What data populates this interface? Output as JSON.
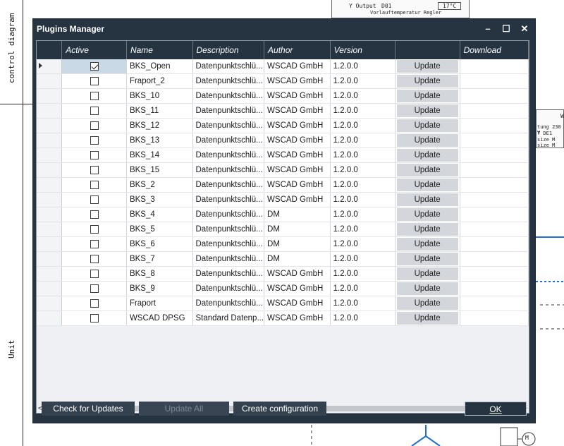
{
  "background": {
    "side_labels": [
      "control diagram",
      "Unit"
    ],
    "top_block": [
      "Y Output",
      "D01",
      "17°C",
      "Vorlauftemperatur Regler"
    ],
    "right_block": [
      "W",
      "tung 230 V",
      "T DE1",
      "size M",
      "size M"
    ]
  },
  "dialog": {
    "title": "Plugins Manager",
    "controls": {
      "minimize": "–",
      "maximize": "☐",
      "close": "✕"
    },
    "columns": [
      "Active",
      "Name",
      "Description",
      "Author",
      "Version",
      "",
      "Download"
    ],
    "rows": [
      {
        "active": true,
        "name": "BKS_Open",
        "description": "Datenpunktschlü...",
        "author": "WSCAD GmbH",
        "version": "1.2.0.0",
        "action": "Update",
        "selected": true
      },
      {
        "active": false,
        "name": "Fraport_2",
        "description": "Datenpunktschlü...",
        "author": "WSCAD GmbH",
        "version": "1.2.0.0",
        "action": "Update"
      },
      {
        "active": false,
        "name": "BKS_10",
        "description": "Datenpunktschlü...",
        "author": "WSCAD GmbH",
        "version": "1.2.0.0",
        "action": "Update"
      },
      {
        "active": false,
        "name": "BKS_11",
        "description": "Datenpunktschlü...",
        "author": "WSCAD GmbH",
        "version": "1.2.0.0",
        "action": "Update"
      },
      {
        "active": false,
        "name": "BKS_12",
        "description": "Datenpunktschlü...",
        "author": "WSCAD GmbH",
        "version": "1.2.0.0",
        "action": "Update"
      },
      {
        "active": false,
        "name": "BKS_13",
        "description": "Datenpunktschlü...",
        "author": "WSCAD GmbH",
        "version": "1.2.0.0",
        "action": "Update"
      },
      {
        "active": false,
        "name": "BKS_14",
        "description": "Datenpunktschlü...",
        "author": "WSCAD GmbH",
        "version": "1.2.0.0",
        "action": "Update"
      },
      {
        "active": false,
        "name": "BKS_15",
        "description": "Datenpunktschlü...",
        "author": "WSCAD GmbH",
        "version": "1.2.0.0",
        "action": "Update"
      },
      {
        "active": false,
        "name": "BKS_2",
        "description": "Datenpunktschlü...",
        "author": "WSCAD GmbH",
        "version": "1.2.0.0",
        "action": "Update"
      },
      {
        "active": false,
        "name": "BKS_3",
        "description": "Datenpunktschlü...",
        "author": "WSCAD GmbH",
        "version": "1.2.0.0",
        "action": "Update"
      },
      {
        "active": false,
        "name": "BKS_4",
        "description": "Datenpunktschlü...",
        "author": "DM",
        "version": "1.2.0.0",
        "action": "Update"
      },
      {
        "active": false,
        "name": "BKS_5",
        "description": "Datenpunktschlü...",
        "author": "DM",
        "version": "1.2.0.0",
        "action": "Update"
      },
      {
        "active": false,
        "name": "BKS_6",
        "description": "Datenpunktschlü...",
        "author": "DM",
        "version": "1.2.0.0",
        "action": "Update"
      },
      {
        "active": false,
        "name": "BKS_7",
        "description": "Datenpunktschlü...",
        "author": "DM",
        "version": "1.2.0.0",
        "action": "Update"
      },
      {
        "active": false,
        "name": "BKS_8",
        "description": "Datenpunktschlü...",
        "author": "WSCAD GmbH",
        "version": "1.2.0.0",
        "action": "Update"
      },
      {
        "active": false,
        "name": "BKS_9",
        "description": "Datenpunktschlü...",
        "author": "WSCAD GmbH",
        "version": "1.2.0.0",
        "action": "Update"
      },
      {
        "active": false,
        "name": "Fraport",
        "description": "Datenpunktschlü...",
        "author": "WSCAD GmbH",
        "version": "1.2.0.0",
        "action": "Update"
      },
      {
        "active": false,
        "name": "WSCAD DPSG",
        "description": "Standard Datenp...",
        "author": "WSCAD GmbH",
        "version": "1.2.0.0",
        "action": "Update"
      }
    ],
    "scroll": {
      "left": "<",
      "right": ">"
    },
    "buttons": {
      "check_updates": "Check for Updates",
      "update_all": "Update All",
      "create_config": "Create configuration",
      "ok": "OK"
    }
  }
}
